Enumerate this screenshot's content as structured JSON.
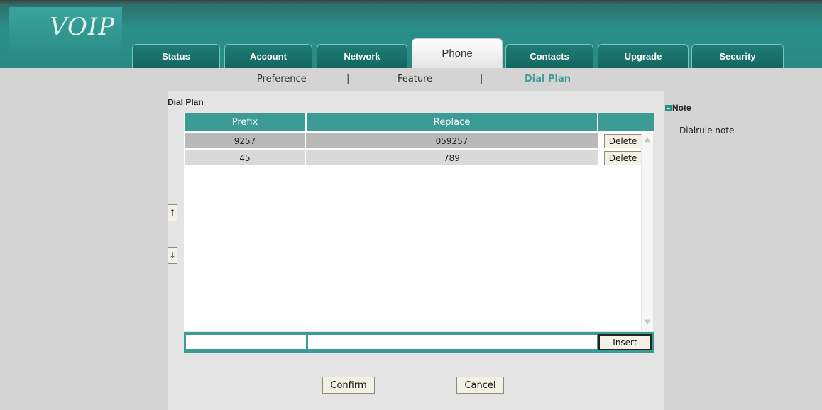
{
  "header": {
    "logo_text": "VOIP",
    "tabs": [
      {
        "label": "Status",
        "active": false
      },
      {
        "label": "Account",
        "active": false
      },
      {
        "label": "Network",
        "active": false
      },
      {
        "label": "Phone",
        "active": true
      },
      {
        "label": "Contacts",
        "active": false
      },
      {
        "label": "Upgrade",
        "active": false
      },
      {
        "label": "Security",
        "active": false
      }
    ]
  },
  "subnav": {
    "items": [
      "Preference",
      "Feature",
      "Dial Plan"
    ],
    "active": "Dial Plan",
    "separator": "|"
  },
  "dial_plan": {
    "title": "Dial Plan",
    "columns": [
      "Prefix",
      "Replace",
      ""
    ],
    "rows": [
      {
        "prefix": "9257",
        "replace": "059257",
        "action": "Delete"
      },
      {
        "prefix": "45",
        "replace": "789",
        "action": "Delete"
      }
    ],
    "move_up_icon": "arrow-up-icon",
    "move_down_icon": "arrow-down-icon",
    "move_up_glyph": "↑",
    "move_down_glyph": "↓",
    "new_prefix_value": "",
    "new_replace_value": "",
    "insert_label": "Insert",
    "confirm_label": "Confirm",
    "cancel_label": "Cancel"
  },
  "note": {
    "title": "Note",
    "icon": "collapse-icon",
    "text": "Dialrule note"
  },
  "colors": {
    "accent": "#3a9c95",
    "header_bg": "#2b8c86",
    "active_subnav": "#3f9c96"
  }
}
